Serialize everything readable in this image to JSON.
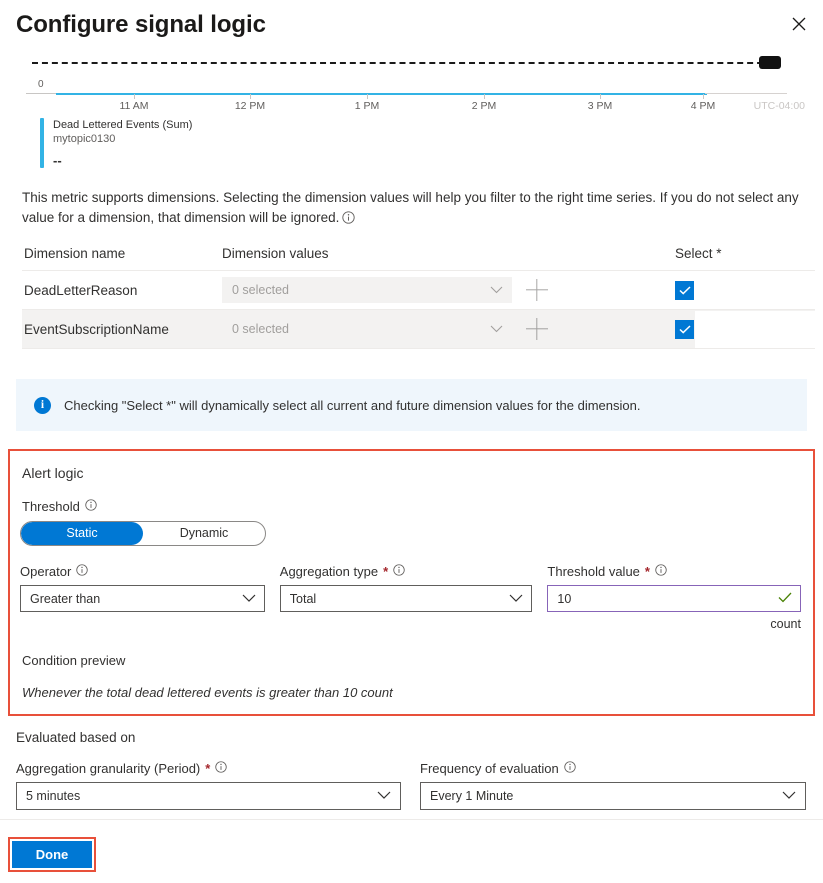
{
  "header": {
    "title": "Configure signal logic",
    "close_icon": "close-icon"
  },
  "chart_data": {
    "type": "line",
    "title": "Dead Lettered Events (Sum)",
    "subtitle": "mytopic0130",
    "value": "--",
    "x": [
      "11 AM",
      "12 PM",
      "1 PM",
      "2 PM",
      "3 PM",
      "4 PM"
    ],
    "values": [
      0,
      0,
      0,
      0,
      0,
      0
    ],
    "ylabel": "",
    "xlabel": "",
    "y_ticks": [
      "0"
    ],
    "ylim": [
      0,
      10
    ],
    "threshold": 10,
    "threshold_style": "dashed",
    "timezone": "UTC-04:00",
    "series_color": "#32b3e5",
    "grid": false,
    "legend": "bottom-left"
  },
  "description": {
    "text": "This metric supports dimensions. Selecting the dimension values will help you filter to the right time series. If you do not select any value for a dimension, that dimension will be ignored.",
    "info_icon": "info-icon"
  },
  "dimensions_table": {
    "headers": {
      "name": "Dimension name",
      "values": "Dimension values",
      "select": "Select *"
    },
    "rows": [
      {
        "name": "DeadLetterReason",
        "value": "0 selected",
        "selected": true
      },
      {
        "name": "EventSubscriptionName",
        "value": "0 selected",
        "selected": true
      }
    ]
  },
  "info_banner": {
    "icon": "info-icon",
    "text": "Checking \"Select *\" will dynamically select all current and future dimension values for the dimension."
  },
  "alert_logic": {
    "title": "Alert logic",
    "highlight_color": "#e8503a",
    "threshold_label": "Threshold",
    "toggle": {
      "options": [
        "Static",
        "Dynamic"
      ],
      "selected": "Static"
    },
    "operator": {
      "label": "Operator",
      "value": "Greater than"
    },
    "aggregation_type": {
      "label": "Aggregation type",
      "required": "*",
      "value": "Total"
    },
    "threshold_value": {
      "label": "Threshold value",
      "required": "*",
      "value": "10",
      "unit": "count",
      "valid": true
    },
    "condition_preview": {
      "label": "Condition preview",
      "text": "Whenever the total dead lettered events is greater than 10 count"
    }
  },
  "evaluated_based_on": {
    "title": "Evaluated based on",
    "granularity": {
      "label": "Aggregation granularity (Period)",
      "required": "*",
      "value": "5 minutes"
    },
    "frequency": {
      "label": "Frequency of evaluation",
      "value": "Every 1 Minute"
    }
  },
  "footer": {
    "done_label": "Done",
    "accent_color": "#0078d4",
    "highlight_color": "#e8503a"
  }
}
